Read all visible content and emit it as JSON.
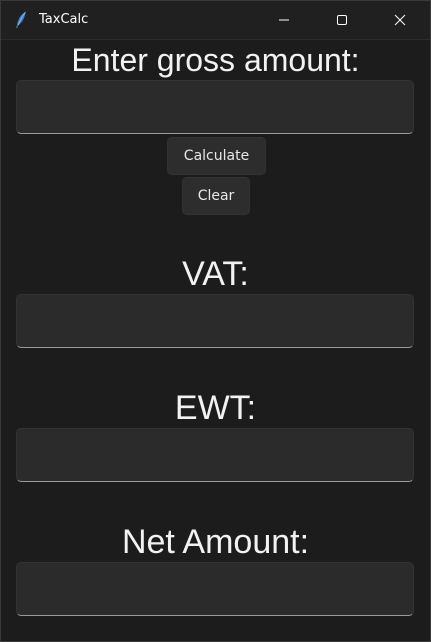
{
  "window": {
    "title": "TaxCalc",
    "icon": "feather-icon",
    "controls": [
      "minimize-icon",
      "maximize-icon",
      "close-icon"
    ]
  },
  "gross": {
    "label": "Enter gross amount:",
    "value": ""
  },
  "buttons": {
    "calculate_label": "Calculate",
    "clear_label": "Clear"
  },
  "vat": {
    "label": "VAT:",
    "value": ""
  },
  "ewt": {
    "label": "EWT:",
    "value": ""
  },
  "net": {
    "label": "Net Amount:",
    "value": ""
  },
  "colors": {
    "background": "#1c1c1c",
    "titlebar": "#202020",
    "field": "#2b2b2b",
    "button": "#2d2d2d",
    "text": "#f2f2f2",
    "icon_accent": "#4a90d9"
  }
}
